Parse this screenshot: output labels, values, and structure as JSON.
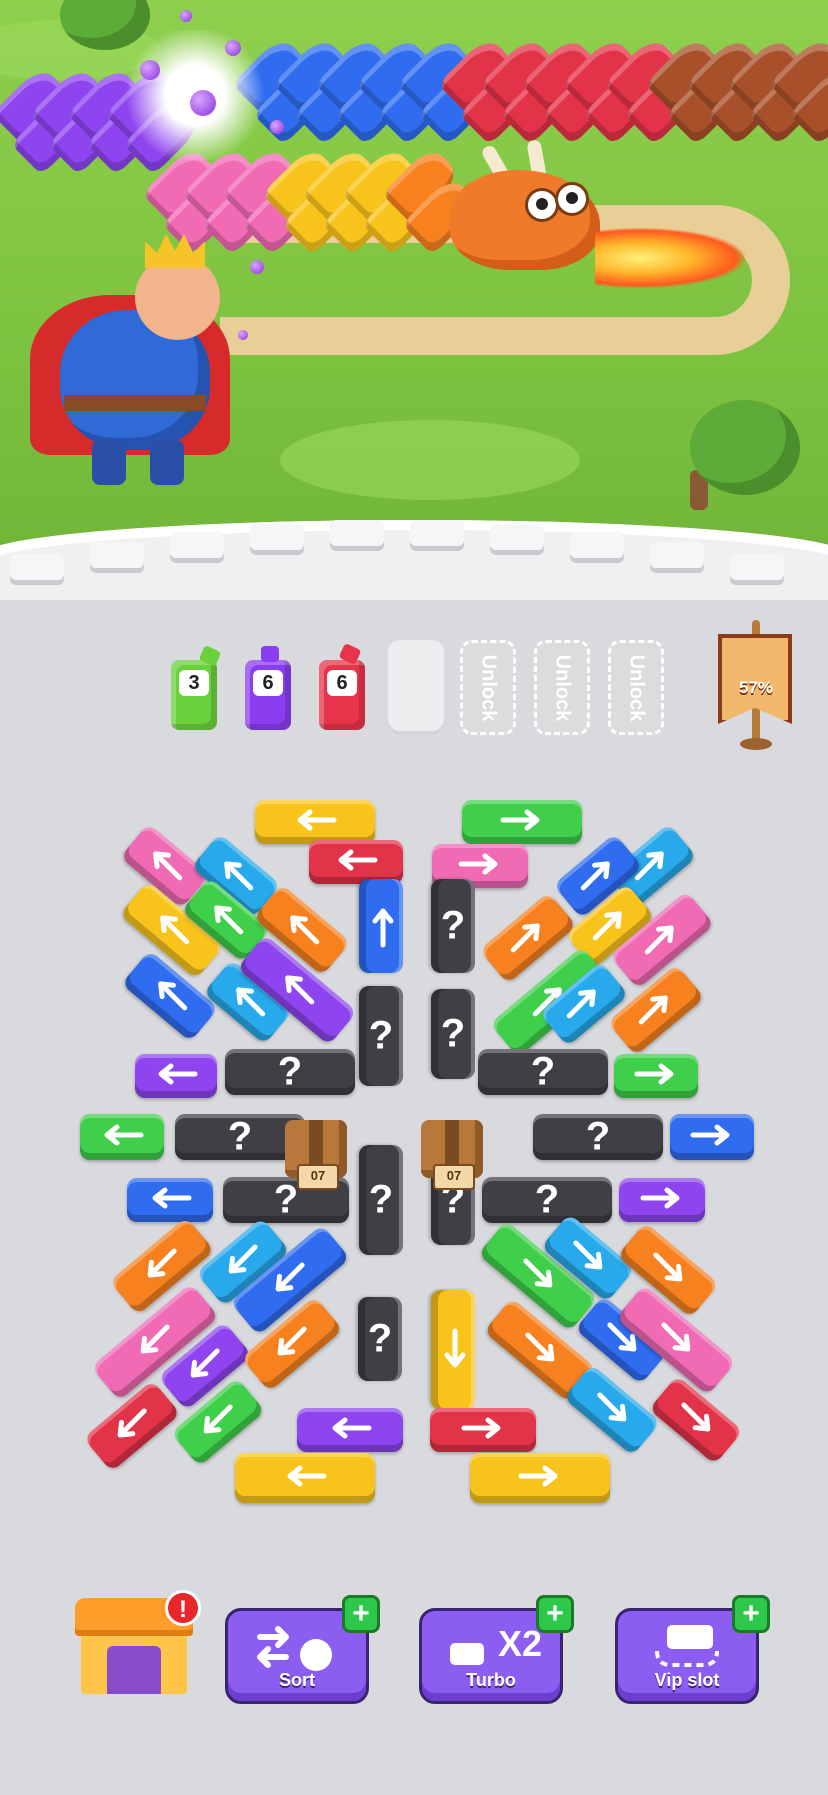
{
  "slots": {
    "filled": [
      {
        "count": "3",
        "color": "#6ad13c"
      },
      {
        "count": "6",
        "color": "#8b3df0"
      },
      {
        "count": "6",
        "color": "#e8344a"
      }
    ],
    "locked_label": "Unlock"
  },
  "progress": {
    "label": "57%",
    "value": 0.57
  },
  "board": {
    "hidden_symbol": "?",
    "chest_timer": "07"
  },
  "toolbar": {
    "shop_badge": "!",
    "sort_label": "Sort",
    "turbo_label": "Turbo",
    "turbo_multiplier": "X2",
    "vip_label": "Vip slot",
    "plus_symbol": "+"
  },
  "colors": {
    "yellow": "#f8c41c",
    "red": "#e33348",
    "green": "#3fcf4a",
    "pink": "#f06ab4",
    "blue": "#2f6cf0",
    "cyan": "#27a9ec",
    "orange": "#f7801f",
    "purple": "#8e44ef",
    "lime": "#62d63a",
    "dark": "#3f3f45"
  }
}
